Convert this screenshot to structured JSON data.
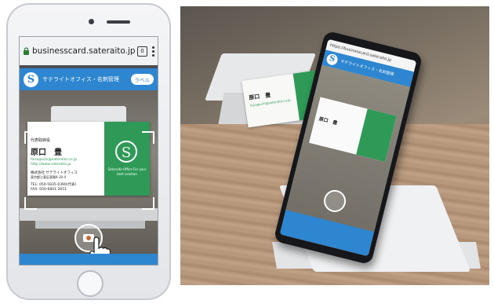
{
  "phone_screen": {
    "url": "businesscard.sateraito.jp",
    "tab_count": "0",
    "app_title": "サテライトオフィス・名刺管理",
    "label_button": "ラベル",
    "logo_letter": "S"
  },
  "business_card": {
    "department": "代表取締役",
    "name": "原口　豊",
    "email": "haraguchi@sateraito.co.jp",
    "website": "http://www.sateraito.jp",
    "company": "株式会社 サテライトオフィス",
    "address": "東京都江東区東陽4-10-4",
    "tel": "TEL: 050-5835-0390(代表)",
    "fax": "FAX: 050-6801-2651",
    "logo_letter": "S",
    "tagline": "Sateraito Office For your best solution"
  },
  "photo_phone": {
    "url": "https://businesscard.sateraito.jp",
    "app_title": "サテライトオフィス・名刺管理",
    "card_name": "原口　豊",
    "logo_letter": "S"
  },
  "colors": {
    "brand_blue": "#2d86cf",
    "card_green": "#2f9a57"
  }
}
